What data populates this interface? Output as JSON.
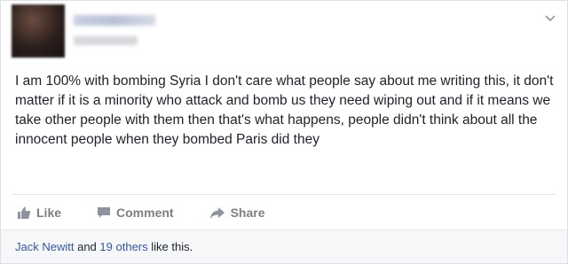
{
  "post": {
    "header": {
      "author_name_blurred": true,
      "timestamp_blurred": true
    },
    "text": "I am 100% with bombing Syria I don't care what people say about me writing this, it don't matter if it is a minority who attack and bomb us they need wiping out and if it means we take other people with them then that's what happens, people didn't think about all the innocent people when they bombed Paris did they"
  },
  "actions": {
    "like_label": "Like",
    "comment_label": "Comment",
    "share_label": "Share"
  },
  "likes_bar": {
    "name": "Jack Newitt",
    "and_text": "and",
    "others": "19 others",
    "suffix": "like this."
  },
  "colors": {
    "link": "#365899",
    "action_gray": "#7f7f7f",
    "text": "#1d2129"
  }
}
